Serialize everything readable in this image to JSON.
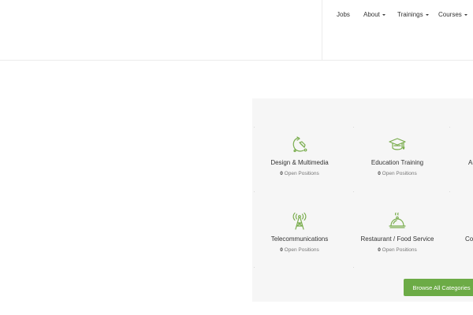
{
  "nav": {
    "items": [
      {
        "label": "Jobs",
        "dropdown": false
      },
      {
        "label": "About",
        "dropdown": true
      },
      {
        "label": "Trainings",
        "dropdown": true
      },
      {
        "label": "Courses",
        "dropdown": true
      }
    ]
  },
  "categories": [
    {
      "title": "Design & Multimedia",
      "count": "0",
      "count_label": "Open Positions",
      "icon": "design-icon"
    },
    {
      "title": "Education Training",
      "count": "0",
      "count_label": "Open Positions",
      "icon": "graduation-cap-icon"
    },
    {
      "title": "Ar",
      "count": "",
      "count_label": "",
      "icon": ""
    },
    {
      "title": "Telecommunications",
      "count": "0",
      "count_label": "Open Positions",
      "icon": "antenna-tower-icon"
    },
    {
      "title": "Restaurant / Food Service",
      "count": "0",
      "count_label": "Open Positions",
      "icon": "food-cloche-icon"
    },
    {
      "title": "Co",
      "count": "",
      "count_label": "",
      "icon": ""
    }
  ],
  "browse": {
    "label": "Browse All Categories"
  },
  "colors": {
    "accent": "#6cab46",
    "icon": "#7aad4e",
    "panel_bg": "#f6f6f6"
  }
}
